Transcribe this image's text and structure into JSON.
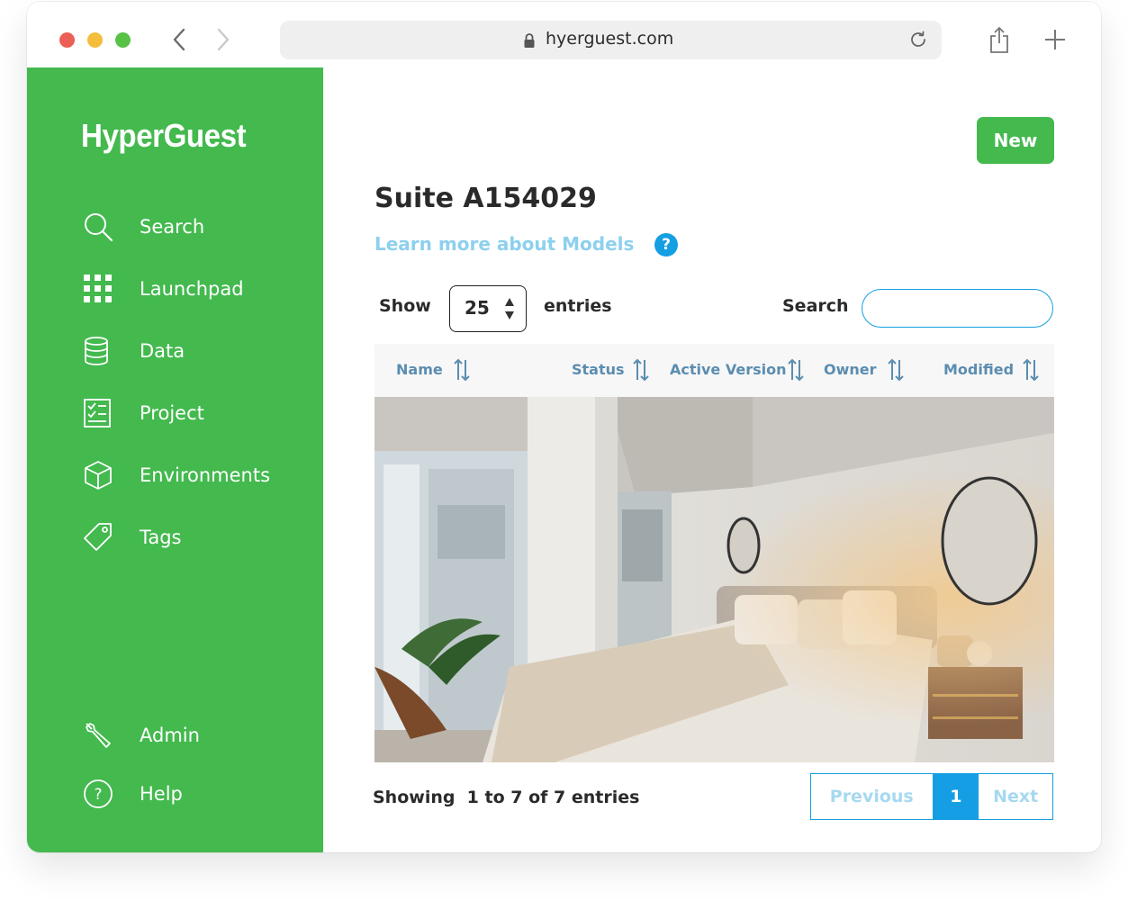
{
  "browser": {
    "url": "hyerguest.com"
  },
  "sidebar": {
    "logo": "HyperGuest",
    "items": [
      {
        "label": "Search",
        "icon": "search-icon"
      },
      {
        "label": "Launchpad",
        "icon": "grid-icon"
      },
      {
        "label": "Data",
        "icon": "database-icon"
      },
      {
        "label": "Project",
        "icon": "checklist-icon"
      },
      {
        "label": "Environments",
        "icon": "cube-icon"
      },
      {
        "label": "Tags",
        "icon": "tag-icon"
      }
    ],
    "bottom_items": [
      {
        "label": "Admin",
        "icon": "wrench-icon"
      },
      {
        "label": "Help",
        "icon": "help-circle-icon"
      }
    ]
  },
  "main": {
    "new_button": "New",
    "title": "Suite A154029",
    "learn_link": "Learn more about Models",
    "help_glyph": "?",
    "show_label": "Show",
    "entries_value": "25",
    "entries_label": "entries",
    "search_label": "Search",
    "search_value": "",
    "columns": [
      "Name",
      "Status",
      "Active Version",
      "Owner",
      "Modified"
    ],
    "image_alt": "bedroom-photo",
    "showing_text": "Showing  1 to 7 of 7 entries",
    "pagination": {
      "previous": "Previous",
      "current": "1",
      "next": "Next"
    }
  },
  "colors": {
    "brand_green": "#43b94e",
    "link_blue": "#159fe3",
    "header_text": "#5b8db0"
  }
}
